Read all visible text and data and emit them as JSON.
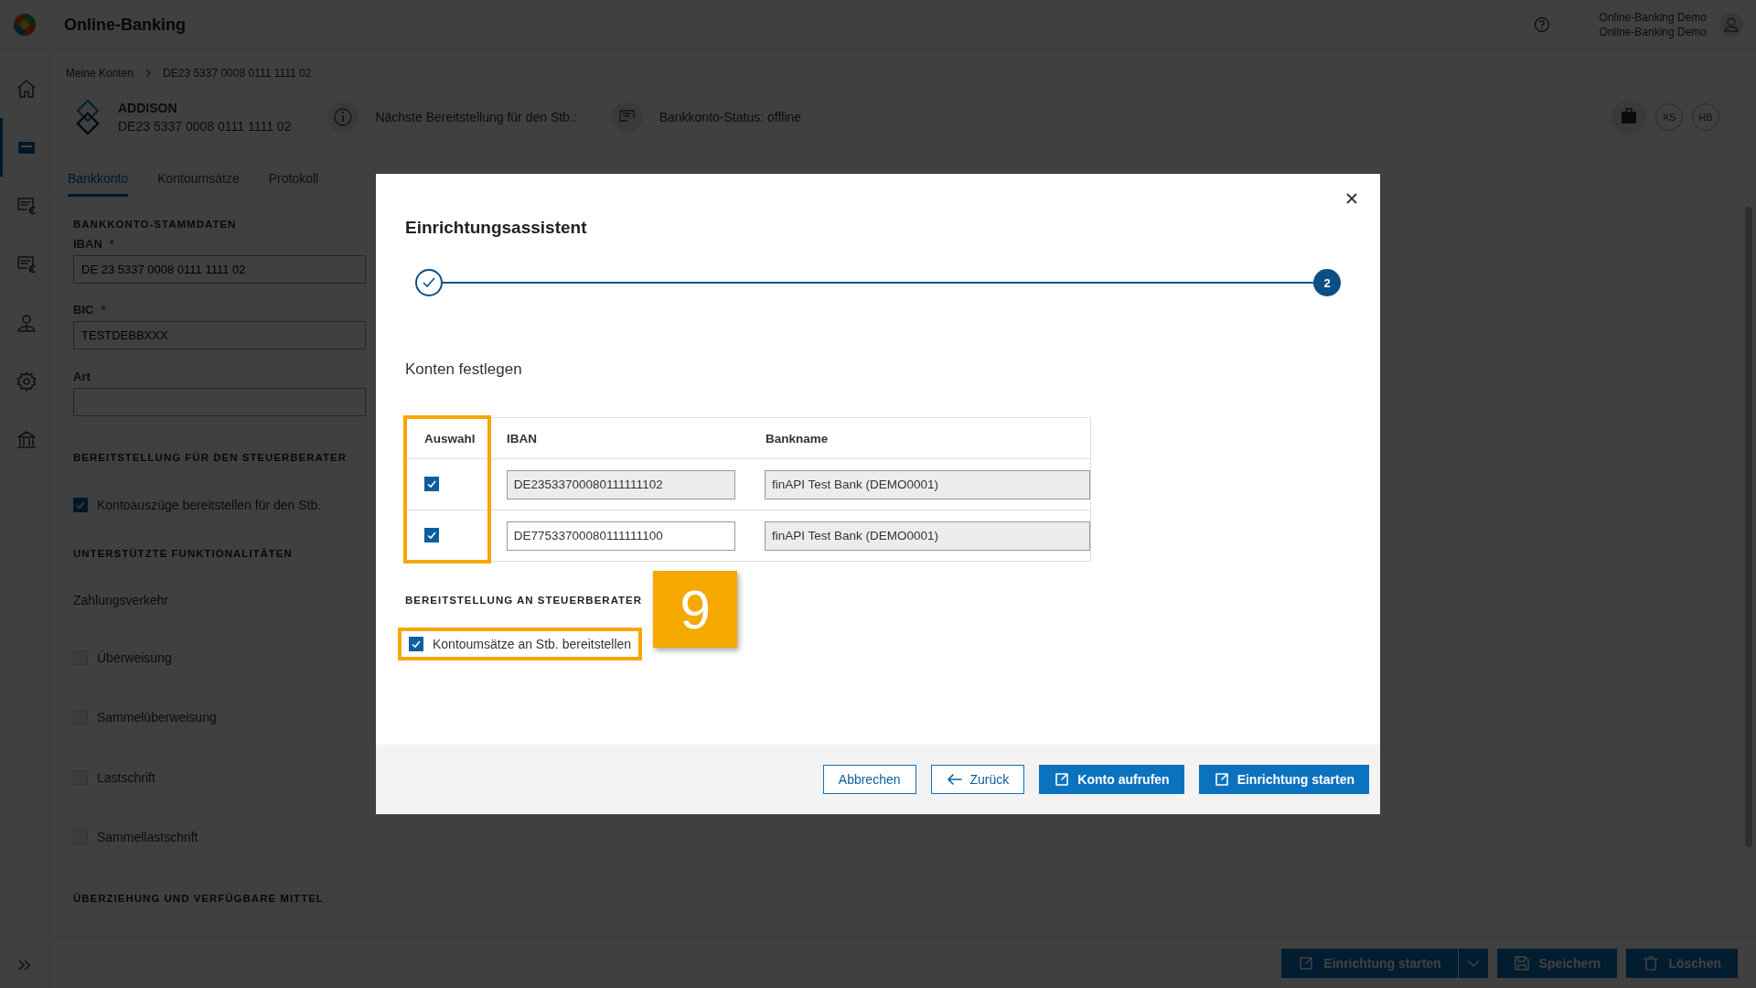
{
  "app": {
    "title": "Online-Banking",
    "user_lines": [
      "Online-Banking Demo",
      "Online-Banking Demo"
    ]
  },
  "nav": {
    "items": [
      {
        "kind": "home",
        "selected": false
      },
      {
        "kind": "accounts",
        "selected": true
      },
      {
        "kind": "invoice",
        "selected": false
      },
      {
        "kind": "invoice",
        "selected": false
      },
      {
        "kind": "person",
        "selected": false
      },
      {
        "kind": "settings",
        "selected": false
      },
      {
        "kind": "bank",
        "selected": false
      }
    ]
  },
  "breadcrumb": [
    "Meine Konten",
    "DE23 5337 0008 0111 1111 02"
  ],
  "account": {
    "name": "ADDISON",
    "iban": "DE23 5337 0008 0111 1111 02",
    "next_provision": "Nächste Bereitstellung für den Stb.:",
    "status": "Bankkonto-Status: offline",
    "initials": [
      "XS",
      "HB"
    ]
  },
  "tabs": [
    {
      "label": "Bankkonto",
      "selected": true
    },
    {
      "label": "Kontoumsätze",
      "selected": false
    },
    {
      "label": "Protokoll",
      "selected": false
    }
  ],
  "form": [
    {
      "kind": "heading",
      "text": "BANKKONTO-STAMMDATEN"
    },
    {
      "kind": "field",
      "label": "IBAN",
      "required_mark": "*",
      "value": "DE 23 5337 0008 0111 1111 02"
    },
    {
      "kind": "field",
      "label": "BIC",
      "required_mark": "*",
      "value": "TESTDEBBXXX"
    },
    {
      "kind": "field",
      "label": "Art"
    },
    {
      "kind": "heading",
      "text": "BEREITSTELLUNG FÜR DEN STEUERBERATER"
    },
    {
      "kind": "checkbox",
      "label": "Kontoauszüge bereitstellen für den Stb.",
      "checked": true
    },
    {
      "kind": "heading",
      "text": "UNTERSTÜTZTE FUNKTIONALITÄTEN"
    },
    {
      "kind": "text",
      "text": "Zahlungsverkehr"
    },
    {
      "kind": "checkbox",
      "label": "Überweisung",
      "checked": false
    },
    {
      "kind": "checkbox",
      "label": "Sammelüberweisung",
      "checked": false
    },
    {
      "kind": "checkbox",
      "label": "Lastschrift",
      "checked": false
    },
    {
      "kind": "checkbox",
      "label": "Sammellastschrift",
      "checked": false
    },
    {
      "kind": "heading",
      "text": "ÜBERZIEHUNG UND VERFÜGBARE MITTEL"
    }
  ],
  "action_bar": [
    {
      "label": "Einrichtung starten",
      "kind": "external"
    },
    {
      "kind": "menu"
    },
    {
      "label": "Speichern",
      "kind": "save"
    },
    {
      "label": "Löschen",
      "kind": "trash"
    }
  ],
  "dialog": {
    "title": "Einrichtungsassistent",
    "steps": [
      {
        "kind": "done"
      },
      {
        "kind": "current",
        "number": "2"
      }
    ],
    "subtitle": "Konten festlegen",
    "table": {
      "selection_column_highlighted": true,
      "columns": [
        {
          "label": "Auswahl"
        },
        {
          "label": "IBAN"
        },
        {
          "label": "Bankname"
        }
      ],
      "rows": [
        {
          "selected": true,
          "iban": "DE23533700080111111102",
          "iban_editable": false,
          "bank": "finAPI Test Bank (DEMO0001)"
        },
        {
          "selected": true,
          "iban": "DE77533700080111111100",
          "iban_editable": true,
          "bank": "finAPI Test Bank (DEMO0001)"
        }
      ]
    },
    "section": "BEREITSTELLUNG AN STEUERBERATER",
    "option": {
      "label": "Kontoumsätze an Stb. bereitstellen",
      "checked": true,
      "highlighted": true
    },
    "badge": "9",
    "buttons": [
      {
        "label": "Abbrechen",
        "kind": "secondary"
      },
      {
        "label": "Zurück",
        "kind": "back"
      },
      {
        "label": "Konto aufrufen",
        "kind": "primary"
      },
      {
        "label": "Einrichtung starten",
        "kind": "primary"
      }
    ]
  }
}
